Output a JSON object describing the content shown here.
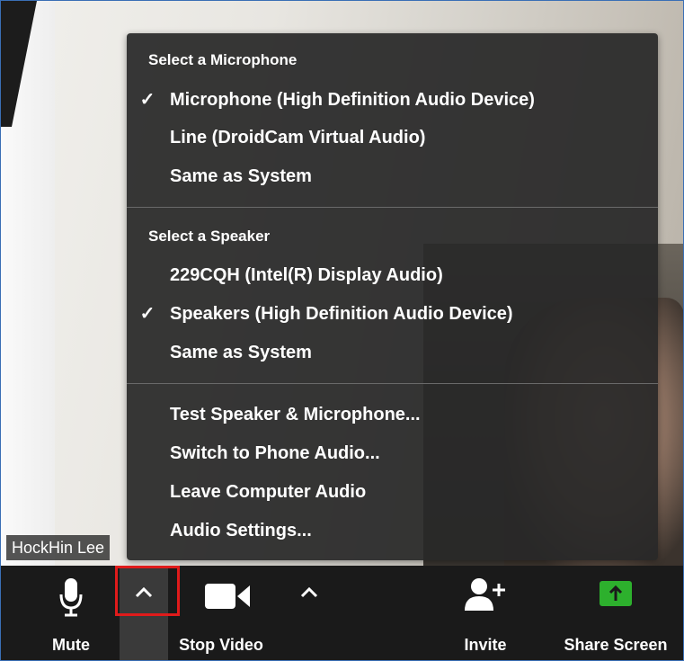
{
  "menu": {
    "microphone_section_title": "Select a Microphone",
    "microphones": [
      {
        "label": "Microphone (High Definition Audio Device)",
        "checked": true
      },
      {
        "label": "Line (DroidCam Virtual Audio)",
        "checked": false
      },
      {
        "label": "Same as System",
        "checked": false
      }
    ],
    "speaker_section_title": "Select a Speaker",
    "speakers": [
      {
        "label": "229CQH (Intel(R) Display Audio)",
        "checked": false
      },
      {
        "label": "Speakers (High Definition Audio Device)",
        "checked": true
      },
      {
        "label": "Same as System",
        "checked": false
      }
    ],
    "actions": [
      {
        "label": "Test Speaker & Microphone..."
      },
      {
        "label": "Switch to Phone Audio..."
      },
      {
        "label": "Leave Computer Audio"
      },
      {
        "label": "Audio Settings..."
      }
    ],
    "check_glyph": "✓"
  },
  "video": {
    "participant_name": "HockHin Lee"
  },
  "toolbar": {
    "mute_label": "Mute",
    "stop_video_label": "Stop Video",
    "invite_label": "Invite",
    "share_screen_label": "Share Screen"
  },
  "colors": {
    "menu_bg": "#282828",
    "toolbar_bg": "#1a1a1a",
    "share_green": "#2db02d",
    "highlight_red": "#e01b1b"
  },
  "icons": {
    "mute": "microphone-icon",
    "audio_options": "chevron-up-icon",
    "stop_video": "video-camera-icon",
    "video_options": "chevron-up-icon",
    "invite": "add-person-icon",
    "share_screen": "share-screen-icon"
  }
}
